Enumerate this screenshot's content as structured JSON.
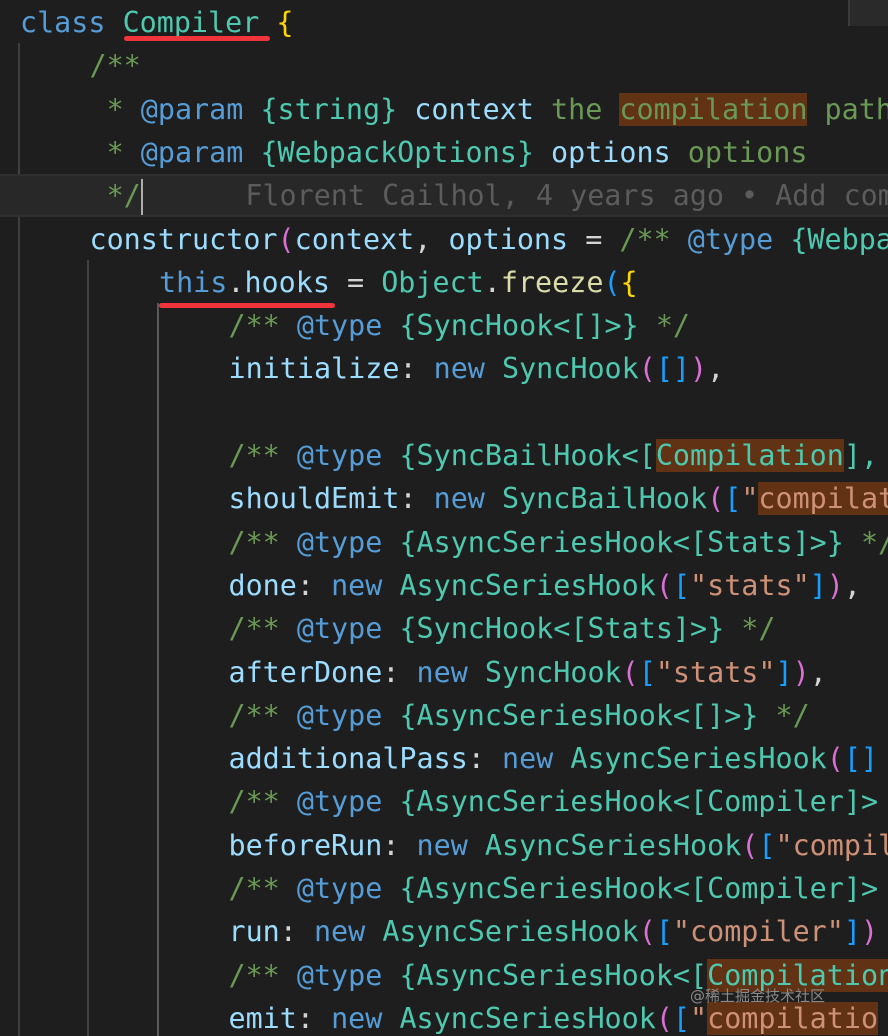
{
  "lines": [
    {
      "indent": 0,
      "tokens": [
        [
          "kw",
          "class "
        ],
        [
          "cls",
          "Compiler"
        ],
        [
          "op",
          " "
        ],
        [
          "p1",
          "{"
        ]
      ]
    },
    {
      "indent": 1,
      "tokens": [
        [
          "cm",
          "/**"
        ]
      ]
    },
    {
      "indent": 1,
      "tokens": [
        [
          "cm",
          " * "
        ],
        [
          "doc",
          "@param "
        ],
        [
          "docty",
          "{string} "
        ],
        [
          "docvar",
          "context "
        ],
        [
          "cm",
          "the "
        ],
        [
          "cmhl",
          "compilation"
        ],
        [
          "cm",
          " path"
        ]
      ]
    },
    {
      "indent": 1,
      "tokens": [
        [
          "cm",
          " * "
        ],
        [
          "doc",
          "@param "
        ],
        [
          "docty",
          "{WebpackOptions} "
        ],
        [
          "docvar",
          "options "
        ],
        [
          "cm",
          "options"
        ]
      ]
    },
    {
      "indent": 1,
      "current": true,
      "tokens": [
        [
          "cm",
          " */"
        ],
        [
          "cursor",
          ""
        ],
        [
          "blame",
          "      Florent Cailhol, 4 years ago • Add comm"
        ]
      ]
    },
    {
      "indent": 1,
      "tokens": [
        [
          "var",
          "constructor"
        ],
        [
          "p2",
          "("
        ],
        [
          "var",
          "context"
        ],
        [
          "op",
          ", "
        ],
        [
          "var",
          "options"
        ],
        [
          "op",
          " = "
        ],
        [
          "cm",
          "/** "
        ],
        [
          "doc",
          "@type "
        ],
        [
          "docty",
          "{Webpa"
        ]
      ]
    },
    {
      "indent": 2,
      "tokens": [
        [
          "kw",
          "this"
        ],
        [
          "op",
          "."
        ],
        [
          "var",
          "hooks"
        ],
        [
          "op",
          " = "
        ],
        [
          "cls",
          "Object"
        ],
        [
          "op",
          "."
        ],
        [
          "fn",
          "freeze"
        ],
        [
          "p3",
          "("
        ],
        [
          "p1",
          "{"
        ]
      ]
    },
    {
      "indent": 3,
      "tokens": [
        [
          "cm",
          "/** "
        ],
        [
          "doc",
          "@type "
        ],
        [
          "docty",
          "{SyncHook<[]>} "
        ],
        [
          "cm",
          "*/"
        ]
      ]
    },
    {
      "indent": 3,
      "tokens": [
        [
          "var",
          "initialize"
        ],
        [
          "op",
          ": "
        ],
        [
          "kw",
          "new "
        ],
        [
          "cls",
          "SyncHook"
        ],
        [
          "p2",
          "("
        ],
        [
          "p3",
          "[]"
        ],
        [
          "p2",
          ")"
        ],
        [
          "op",
          ","
        ]
      ]
    },
    {
      "indent": 3,
      "tokens": []
    },
    {
      "indent": 3,
      "tokens": [
        [
          "cm",
          "/** "
        ],
        [
          "doc",
          "@type "
        ],
        [
          "docty",
          "{SyncBailHook<["
        ],
        [
          "dochl",
          "Compilation"
        ],
        [
          "docty",
          "], "
        ]
      ]
    },
    {
      "indent": 3,
      "tokens": [
        [
          "var",
          "shouldEmit"
        ],
        [
          "op",
          ": "
        ],
        [
          "kw",
          "new "
        ],
        [
          "cls",
          "SyncBailHook"
        ],
        [
          "p2",
          "("
        ],
        [
          "p3",
          "["
        ],
        [
          "str",
          "\""
        ],
        [
          "strhl",
          "compilat"
        ]
      ]
    },
    {
      "indent": 3,
      "tokens": [
        [
          "cm",
          "/** "
        ],
        [
          "doc",
          "@type "
        ],
        [
          "docty",
          "{AsyncSeriesHook<[Stats]>} "
        ],
        [
          "cm",
          "*/"
        ]
      ]
    },
    {
      "indent": 3,
      "tokens": [
        [
          "var",
          "done"
        ],
        [
          "op",
          ": "
        ],
        [
          "kw",
          "new "
        ],
        [
          "cls",
          "AsyncSeriesHook"
        ],
        [
          "p2",
          "("
        ],
        [
          "p3",
          "["
        ],
        [
          "str",
          "\"stats\""
        ],
        [
          "p3",
          "]"
        ],
        [
          "p2",
          ")"
        ],
        [
          "op",
          ","
        ]
      ]
    },
    {
      "indent": 3,
      "tokens": [
        [
          "cm",
          "/** "
        ],
        [
          "doc",
          "@type "
        ],
        [
          "docty",
          "{SyncHook<[Stats]>} "
        ],
        [
          "cm",
          "*/"
        ]
      ]
    },
    {
      "indent": 3,
      "tokens": [
        [
          "var",
          "afterDone"
        ],
        [
          "op",
          ": "
        ],
        [
          "kw",
          "new "
        ],
        [
          "cls",
          "SyncHook"
        ],
        [
          "p2",
          "("
        ],
        [
          "p3",
          "["
        ],
        [
          "str",
          "\"stats\""
        ],
        [
          "p3",
          "]"
        ],
        [
          "p2",
          ")"
        ],
        [
          "op",
          ","
        ]
      ]
    },
    {
      "indent": 3,
      "tokens": [
        [
          "cm",
          "/** "
        ],
        [
          "doc",
          "@type "
        ],
        [
          "docty",
          "{AsyncSeriesHook<[]>} "
        ],
        [
          "cm",
          "*/"
        ]
      ]
    },
    {
      "indent": 3,
      "tokens": [
        [
          "var",
          "additionalPass"
        ],
        [
          "op",
          ": "
        ],
        [
          "kw",
          "new "
        ],
        [
          "cls",
          "AsyncSeriesHook"
        ],
        [
          "p2",
          "("
        ],
        [
          "p3",
          "[]"
        ]
      ]
    },
    {
      "indent": 3,
      "tokens": [
        [
          "cm",
          "/** "
        ],
        [
          "doc",
          "@type "
        ],
        [
          "docty",
          "{AsyncSeriesHook<[Compiler]>"
        ]
      ]
    },
    {
      "indent": 3,
      "tokens": [
        [
          "var",
          "beforeRun"
        ],
        [
          "op",
          ": "
        ],
        [
          "kw",
          "new "
        ],
        [
          "cls",
          "AsyncSeriesHook"
        ],
        [
          "p2",
          "("
        ],
        [
          "p3",
          "["
        ],
        [
          "str",
          "\"compil"
        ]
      ]
    },
    {
      "indent": 3,
      "tokens": [
        [
          "cm",
          "/** "
        ],
        [
          "doc",
          "@type "
        ],
        [
          "docty",
          "{AsyncSeriesHook<[Compiler]>"
        ]
      ]
    },
    {
      "indent": 3,
      "tokens": [
        [
          "var",
          "run"
        ],
        [
          "op",
          ": "
        ],
        [
          "kw",
          "new "
        ],
        [
          "cls",
          "AsyncSeriesHook"
        ],
        [
          "p2",
          "("
        ],
        [
          "p3",
          "["
        ],
        [
          "str",
          "\"compiler\""
        ],
        [
          "p3",
          "]"
        ],
        [
          "p2",
          ")"
        ]
      ]
    },
    {
      "indent": 3,
      "tokens": [
        [
          "cm",
          "/** "
        ],
        [
          "doc",
          "@type "
        ],
        [
          "docty",
          "{AsyncSeriesHook<["
        ],
        [
          "dochl",
          "Compilation"
        ]
      ]
    },
    {
      "indent": 3,
      "tokens": [
        [
          "var",
          "emit"
        ],
        [
          "op",
          ": "
        ],
        [
          "kw",
          "new "
        ],
        [
          "cls",
          "AsyncSeriesHook"
        ],
        [
          "p2",
          "("
        ],
        [
          "p3",
          "["
        ],
        [
          "str",
          "\""
        ],
        [
          "strhl",
          "compilatio"
        ]
      ]
    }
  ],
  "watermark": "@稀土掘金技术社区",
  "colors": {
    "background": "#1e1e1e",
    "keyword": "#569cd6",
    "class": "#4ec9b0",
    "string": "#ce9178",
    "comment": "#6a9955",
    "underline": "#f0343b",
    "find_highlight": "#613214"
  }
}
